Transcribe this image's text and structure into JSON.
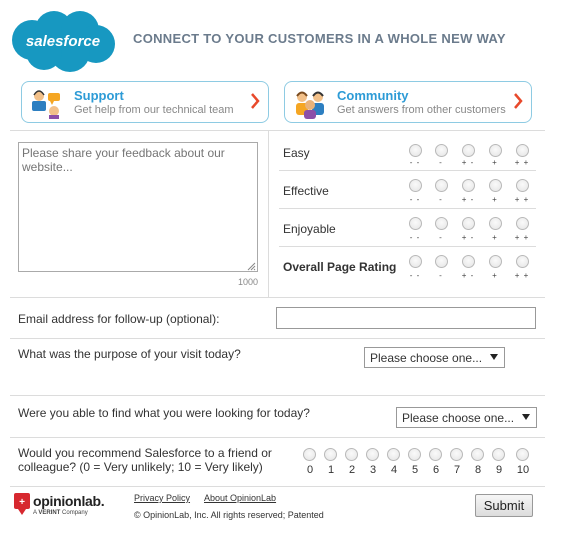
{
  "header": {
    "logo_text": "salesforce",
    "tagline": "CONNECT TO YOUR CUSTOMERS IN A WHOLE NEW WAY",
    "brand_color": "#1798c1"
  },
  "cards": {
    "support": {
      "title": "Support",
      "subtitle": "Get help from our technical team",
      "icon": "support-agent-icon"
    },
    "community": {
      "title": "Community",
      "subtitle": "Get answers from other customers",
      "icon": "community-people-icon"
    },
    "accent": "#2d9bd6",
    "arrow_color": "#e8492b"
  },
  "feedback": {
    "placeholder": "Please share your feedback about our website...",
    "max_chars": "1000"
  },
  "ratings": {
    "scale_labels": [
      "- -",
      "-",
      "+ -",
      "+",
      "+ +"
    ],
    "rows": [
      {
        "label": "Easy"
      },
      {
        "label": "Effective"
      },
      {
        "label": "Enjoyable"
      },
      {
        "label": "Overall Page Rating"
      }
    ]
  },
  "questions": {
    "email_label": "Email address for follow-up (optional):",
    "email_value": "",
    "purpose_label": "What was the purpose of your visit today?",
    "purpose_selected": "Please choose one...",
    "find_label": "Were you able to find what you were looking for today?",
    "find_selected": "Please choose one...",
    "recommend_line1": "Would you recommend Salesforce to a friend or",
    "recommend_line2": "colleague? (0 = Very unlikely; 10 = Very likely)",
    "nps_scale": [
      "0",
      "1",
      "2",
      "3",
      "4",
      "5",
      "6",
      "7",
      "8",
      "9",
      "10"
    ]
  },
  "footer": {
    "brand_name": "opinionlab.",
    "brand_sub_prefix": "A ",
    "brand_sub_bold": "VERINT",
    "brand_sub_suffix": " Company",
    "brand_color": "#d7282f",
    "privacy_link": "Privacy Policy",
    "about_link": "About OpinionLab",
    "copyright": "© OpinionLab, Inc. All rights reserved; Patented",
    "submit_label": "Submit"
  }
}
